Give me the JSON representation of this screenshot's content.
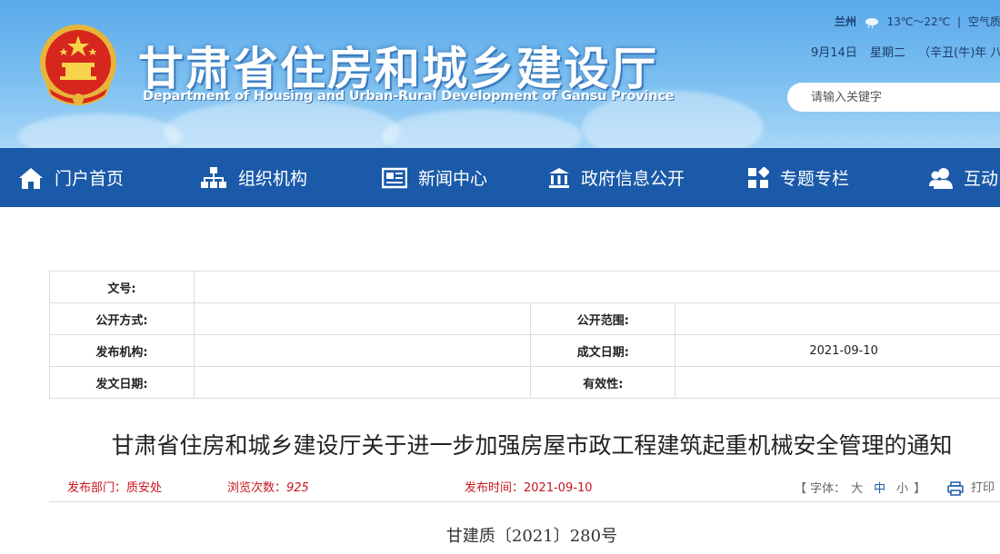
{
  "header": {
    "title": "甘肃省住房和城乡建设厅",
    "subtitle": "Department of Housing and Urban-Rural Development of Gansu Province",
    "weather": {
      "city": "兰州",
      "temp": "13℃～22℃",
      "sep": "|",
      "air": "空气质量"
    },
    "date": {
      "day": "9月14日",
      "weekday": "星期二",
      "lunar": "（辛丑(牛)年 八"
    },
    "search": {
      "placeholder": "请输入关键字"
    }
  },
  "nav": {
    "items": [
      {
        "label": "门户首页",
        "icon": "home-icon"
      },
      {
        "label": "组织机构",
        "icon": "org-chart-icon"
      },
      {
        "label": "新闻中心",
        "icon": "news-icon"
      },
      {
        "label": "政府信息公开",
        "icon": "government-building-icon"
      },
      {
        "label": "专题专栏",
        "icon": "grid-icon"
      },
      {
        "label": "互动",
        "icon": "users-icon"
      }
    ]
  },
  "meta": {
    "doc_no_label": "文号:",
    "doc_no_value": "",
    "open_method_label": "公开方式:",
    "open_method_value": "",
    "open_scope_label": "公开范围:",
    "open_scope_value": "",
    "issuer_label": "发布机构:",
    "issuer_value": "",
    "written_date_label": "成文日期:",
    "written_date_value": "2021-09-10",
    "issue_date_label": "发文日期:",
    "issue_date_value": "",
    "validity_label": "有效性:",
    "validity_value": ""
  },
  "article": {
    "title": "甘肃省住房和城乡建设厅关于进一步加强房屋市政工程建筑起重机械安全管理的通知",
    "dept_label": "发布部门：",
    "dept_value": "质安处",
    "views_label": "浏览次数：",
    "views_value": "925",
    "time_label": "发布时间：",
    "time_value": "2021-09-10",
    "fontsize_open": "【 字体：",
    "font_large": "大",
    "font_medium": "中",
    "font_small": "小",
    "fontsize_close": "】",
    "print_label": "打印",
    "doc_number": "甘建质〔2021〕280号"
  },
  "colors": {
    "nav_bg": "#1b5aa8",
    "accent_red": "#c8161d",
    "header_sky": "#6fb7ee"
  }
}
